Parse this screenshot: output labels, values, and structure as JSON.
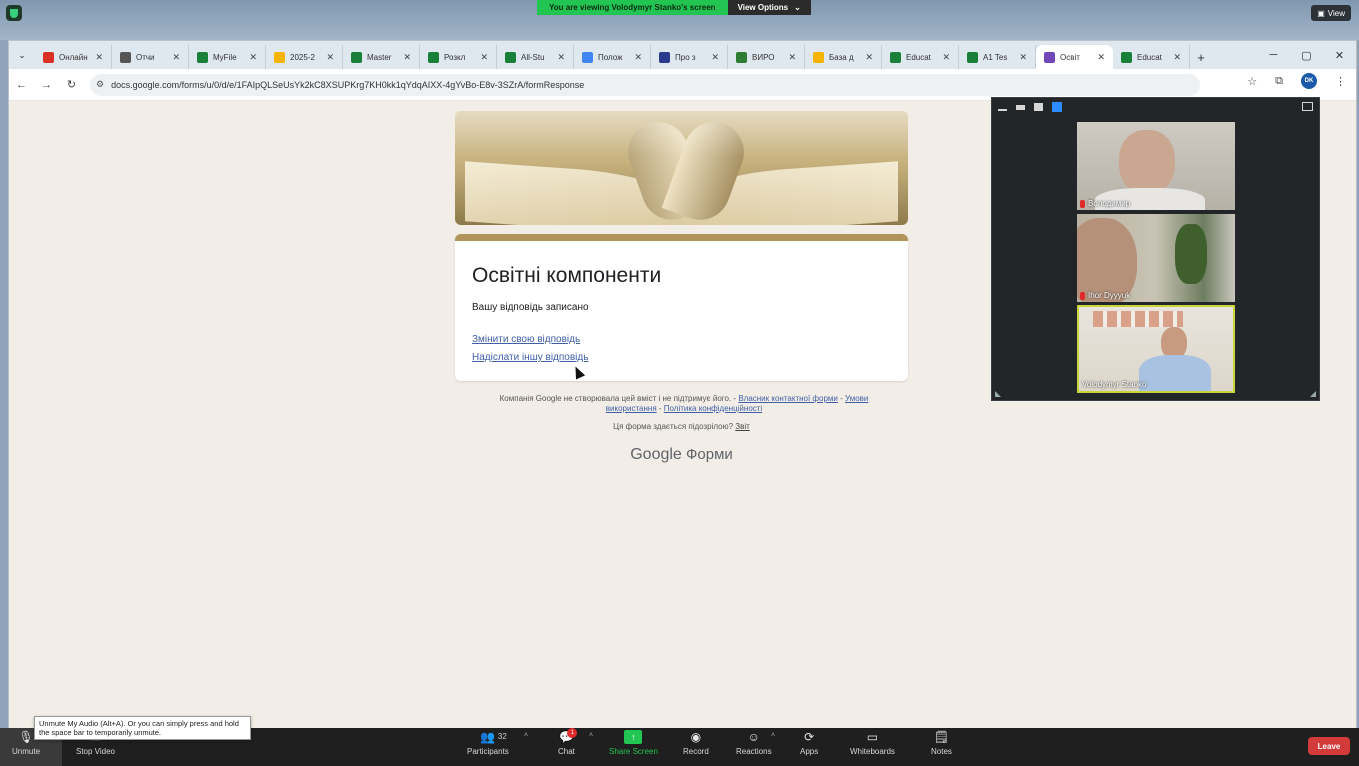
{
  "zoom_top": {
    "share_notice": "You are viewing Volodymyr Stanko's screen",
    "view_options": "View Options",
    "view_button": "View"
  },
  "browser": {
    "tabs": [
      {
        "label": "Онлайн",
        "favicon": "gmail-icon",
        "color": "#d93025"
      },
      {
        "label": "Отчи",
        "favicon": "scan-icon",
        "color": "#555555"
      },
      {
        "label": "MyFile",
        "favicon": "sheets-icon",
        "color": "#188038"
      },
      {
        "label": "2025-2",
        "favicon": "drive-icon",
        "color": "#f4b400"
      },
      {
        "label": "Master",
        "favicon": "sheets-icon",
        "color": "#188038"
      },
      {
        "label": "Розкл",
        "favicon": "sheets-icon",
        "color": "#188038"
      },
      {
        "label": "All-Stu",
        "favicon": "sheets-icon",
        "color": "#188038"
      },
      {
        "label": "Полож",
        "favicon": "google-icon",
        "color": "#4285f4"
      },
      {
        "label": "Про з",
        "favicon": "doc-icon",
        "color": "#2a3a8c"
      },
      {
        "label": "ВИРО",
        "favicon": "shield-icon",
        "color": "#2e7d32"
      },
      {
        "label": "База д",
        "favicon": "drive-icon",
        "color": "#f4b400"
      },
      {
        "label": "Educat",
        "favicon": "sheets-icon",
        "color": "#188038"
      },
      {
        "label": "A1 Tes",
        "favicon": "sheets-icon",
        "color": "#188038"
      },
      {
        "label": "Освіт",
        "favicon": "forms-icon",
        "color": "#7248b9",
        "active": true
      },
      {
        "label": "Educat",
        "favicon": "sheets-icon",
        "color": "#188038"
      }
    ],
    "url": "docs.google.com/forms/u/0/d/e/1FAIpQLSeUsYk2kC8XSUPKrg7KH0kk1qYdqAIXX-4gYvBo-E8v-3SZrA/formResponse",
    "profile_initials": "DK"
  },
  "form": {
    "title": "Освітні компоненти",
    "confirmation": "Вашу відповідь записано",
    "edit_link": "Змінити свою відповідь",
    "another_link": "Надіслати іншу відповідь",
    "footer_text": "Компанія Google не створювала цей вміст і не підтримує його. -",
    "footer_link1": "Власник контактної форми",
    "footer_sep1": " - ",
    "footer_link2": "Умови використання",
    "footer_sep2": " - ",
    "footer_link3": "Політика конфіденційності",
    "suspicious_text": "Ця форма здається підозрілою?",
    "report_link": "Звіт",
    "brand_google": "Google",
    "brand_forms": "Форми"
  },
  "participants_panel": {
    "tiles": [
      {
        "name": "Володимир",
        "muted": true
      },
      {
        "name": "Ihor Dyyyuk",
        "muted": true
      },
      {
        "name": "Volodymyr Stanko",
        "muted": false,
        "active_speaker": true
      }
    ]
  },
  "zoom_bar": {
    "unmute": "Unmute",
    "stop_video": "Stop Video",
    "tooltip": "Unmute My Audio (Alt+A). Or you can simply press and hold the space bar to temporarily unmute.",
    "participants": "Participants",
    "participants_count": "32",
    "chat": "Chat",
    "chat_badge": "1",
    "share_screen": "Share Screen",
    "record": "Record",
    "reactions": "Reactions",
    "apps": "Apps",
    "whiteboards": "Whiteboards",
    "notes": "Notes",
    "leave": "Leave"
  }
}
